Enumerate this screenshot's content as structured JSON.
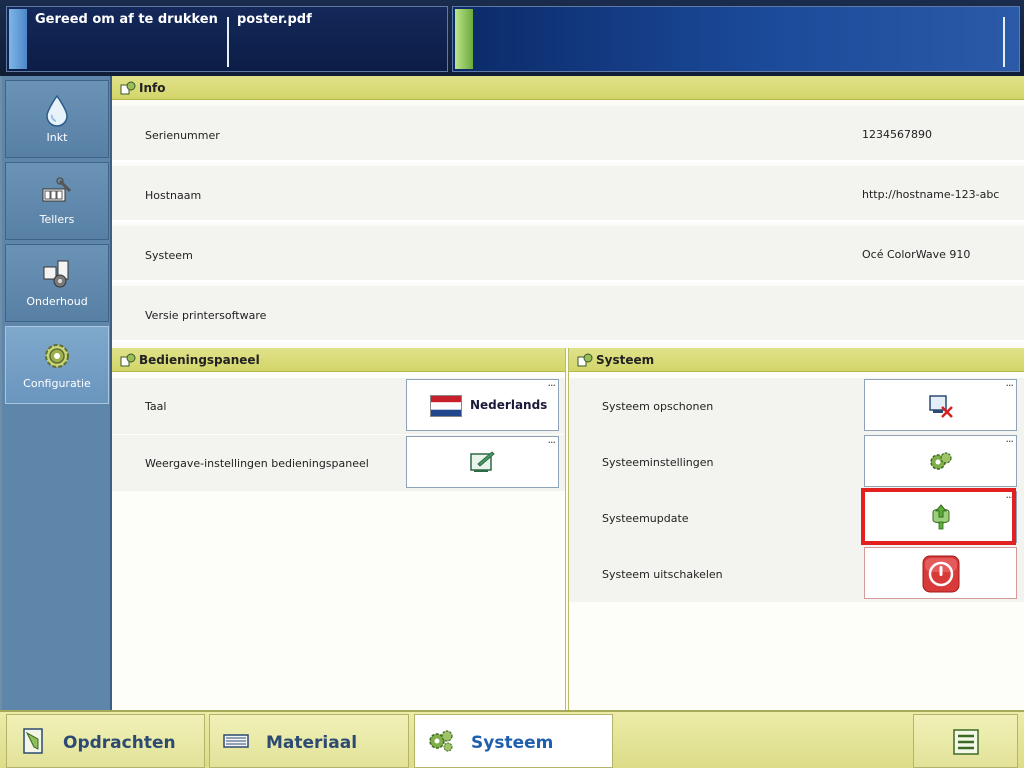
{
  "status_bar": {
    "status_text": "Gereed om af te drukken",
    "job_name": "poster.pdf"
  },
  "nav": {
    "items": [
      {
        "label": "Inkt",
        "icon": "ink-drop-icon"
      },
      {
        "label": "Tellers",
        "icon": "counters-icon"
      },
      {
        "label": "Onderhoud",
        "icon": "maintenance-icon"
      },
      {
        "label": "Configuratie",
        "icon": "configuration-gear-icon",
        "active": true
      }
    ]
  },
  "info": {
    "title": "Info",
    "rows": [
      {
        "label": "Serienummer",
        "value": "1234567890"
      },
      {
        "label": "Hostnaam",
        "value": "http://hostname-123-abc"
      },
      {
        "label": "Systeem",
        "value": "Océ ColorWave 910"
      },
      {
        "label": "Versie printersoftware",
        "value": ""
      }
    ]
  },
  "control_panel": {
    "title": "Bedieningspaneel",
    "rows": [
      {
        "label": "Taal",
        "button_label": "Nederlands",
        "icon": "dutch-flag-icon"
      },
      {
        "label": "Weergave-instellingen bedieningspaneel",
        "icon": "display-settings-icon"
      }
    ]
  },
  "system": {
    "title": "Systeem",
    "rows": [
      {
        "label": "Systeem opschonen",
        "icon": "system-cleanup-icon"
      },
      {
        "label": "Systeeminstellingen",
        "icon": "system-settings-icon"
      },
      {
        "label": "Systeemupdate",
        "icon": "system-update-icon"
      },
      {
        "label": "Systeem uitschakelen",
        "icon": "power-icon"
      }
    ]
  },
  "more_indicator": "...",
  "bottom_tabs": {
    "jobs": "Opdrachten",
    "media": "Materiaal",
    "system": "Systeem",
    "menu_icon": "menu-icon"
  },
  "colors": {
    "section_header": "#d8da78",
    "nav_background": "#5e86aa",
    "accent_blue": "#1f5fae",
    "highlight_red": "#e22020"
  }
}
